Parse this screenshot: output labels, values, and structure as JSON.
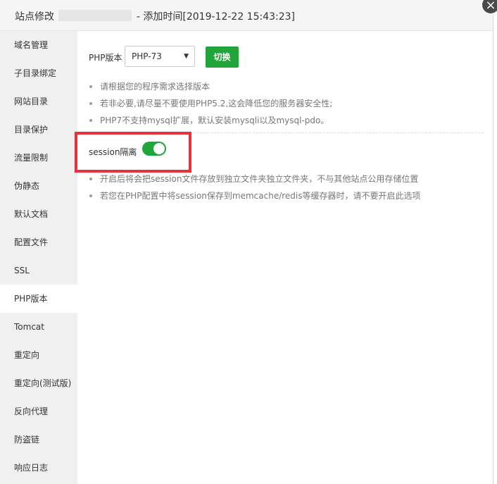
{
  "dialog": {
    "title_prefix": "站点修改",
    "title_suffix": "- 添加时间[2019-12-22 15:43:23]",
    "close_glyph": "×"
  },
  "sidebar": {
    "items": [
      {
        "label": "域名管理"
      },
      {
        "label": "子目录绑定"
      },
      {
        "label": "网站目录"
      },
      {
        "label": "目录保护"
      },
      {
        "label": "流量限制"
      },
      {
        "label": "伪静态"
      },
      {
        "label": "默认文档"
      },
      {
        "label": "配置文件"
      },
      {
        "label": "SSL"
      },
      {
        "label": "PHP版本"
      },
      {
        "label": "Tomcat"
      },
      {
        "label": "重定向"
      },
      {
        "label": "重定向(测试版)"
      },
      {
        "label": "反向代理"
      },
      {
        "label": "防盗链"
      },
      {
        "label": "响应日志"
      }
    ],
    "active": "PHP版本"
  },
  "php": {
    "version_label": "PHP版本",
    "selected_version": "PHP-73",
    "switch_label": "切换",
    "tips": [
      "请根据您的程序需求选择版本",
      "若非必要,请尽量不要使用PHP5.2,这会降低您的服务器安全性;",
      "PHP7不支持mysql扩展，默认安装mysqli以及mysql-pdo。"
    ]
  },
  "session": {
    "label": "session隔离",
    "enabled": true,
    "tips": [
      "开启后将会把session文件存放到独立文件夹独立文件夹，不与其他站点公用存储位置",
      "若您在PHP配置中将session保存到memcache/redis等缓存器时，请不要开启此选项"
    ]
  },
  "colors": {
    "accent": "#20a53a",
    "highlight": "#e8313a"
  }
}
